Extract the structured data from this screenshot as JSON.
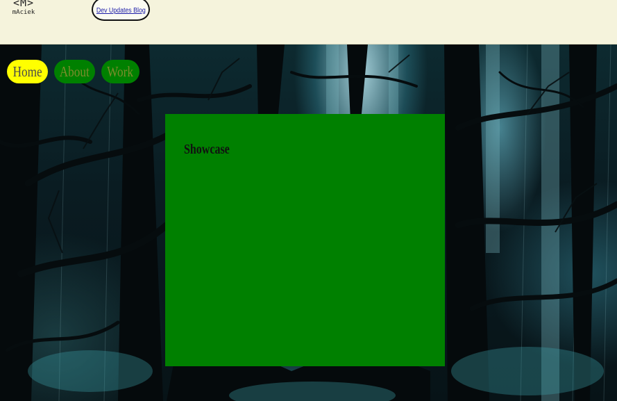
{
  "header": {
    "logo": {
      "mark": "<M>",
      "text": "mAciek"
    },
    "blog_link": "Dev Updates Blog"
  },
  "nav": {
    "items": [
      {
        "label": "Home",
        "active": true
      },
      {
        "label": "About",
        "active": false
      },
      {
        "label": "Work",
        "active": false
      }
    ]
  },
  "main": {
    "panel_title": "Showcase"
  },
  "colors": {
    "header_bg": "#f5f3dc",
    "active_pill": "#ffff00",
    "pill": "#008000",
    "panel": "#008000",
    "link": "#1a1aa8"
  }
}
